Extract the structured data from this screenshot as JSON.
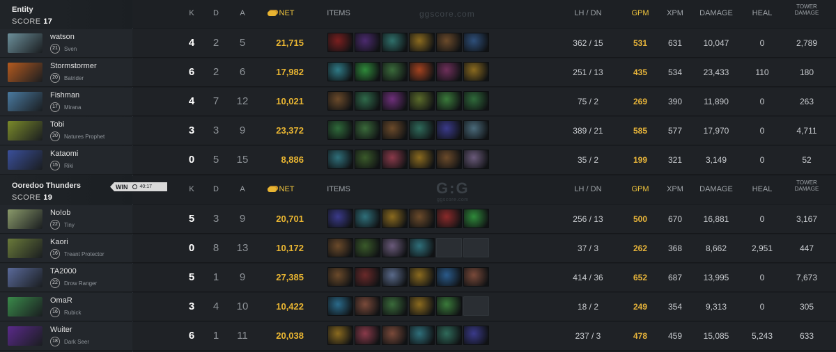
{
  "columns": {
    "k": "K",
    "d": "D",
    "a": "A",
    "net": "NET",
    "items": "ITEMS",
    "lh_dn": "LH  /  DN",
    "gpm": "GPM",
    "xpm": "XPM",
    "damage": "DAMAGE",
    "heal": "HEAL",
    "tower_damage_1": "TOWER",
    "tower_damage_2": "DAMAGE"
  },
  "watermark": {
    "top": "ggscore.com",
    "logo": "G:G",
    "logo_sub": "ggscore.com"
  },
  "teams": [
    {
      "name": "Entity",
      "score_label": "SCORE",
      "score": "17",
      "players": [
        {
          "name": "watson",
          "level": "21",
          "hero": "Sven",
          "k": "4",
          "d": "2",
          "a": "5",
          "net": "21,715",
          "lh": "362",
          "dn": "15",
          "gpm": "531",
          "xpm": "631",
          "damage": "10,047",
          "heal": "0",
          "tower": "2,789",
          "colors": [
            "#7a1f1f",
            "#4b2a6e",
            "#2f6f6a",
            "#8a6a1f",
            "#6b4a2a",
            "#2e4f7a"
          ]
        },
        {
          "name": "Stormstormer",
          "level": "20",
          "hero": "Batrider",
          "k": "6",
          "d": "2",
          "a": "6",
          "net": "17,982",
          "lh": "251",
          "dn": "13",
          "gpm": "435",
          "xpm": "534",
          "damage": "23,433",
          "heal": "110",
          "tower": "180",
          "colors": [
            "#2f7a86",
            "#2f8a3a",
            "#3a6a3a",
            "#a3421f",
            "#6e2f5a",
            "#8a6a1f"
          ]
        },
        {
          "name": "Fishman",
          "level": "17",
          "hero": "Mirana",
          "k": "4",
          "d": "7",
          "a": "12",
          "net": "10,021",
          "lh": "75",
          "dn": "2",
          "gpm": "269",
          "xpm": "390",
          "damage": "11,890",
          "heal": "0",
          "tower": "263",
          "colors": [
            "#6b4a2a",
            "#2f6a4a",
            "#6e2f7a",
            "#5a6a2a",
            "#3a7a3a",
            "#2f6a3a"
          ]
        },
        {
          "name": "Tobi",
          "level": "20",
          "hero": "Natures Prophet",
          "k": "3",
          "d": "3",
          "a": "9",
          "net": "23,372",
          "lh": "389",
          "dn": "21",
          "gpm": "585",
          "xpm": "577",
          "damage": "17,970",
          "heal": "0",
          "tower": "4,711",
          "colors": [
            "#2f6a3a",
            "#3a6a3a",
            "#6b4a2a",
            "#2f6a5a",
            "#3a3a8a",
            "#4a6a7a"
          ]
        },
        {
          "name": "Kataomi",
          "level": "15",
          "hero": "Riki",
          "k": "0",
          "d": "5",
          "a": "15",
          "net": "8,886",
          "lh": "35",
          "dn": "2",
          "gpm": "199",
          "xpm": "321",
          "damage": "3,149",
          "heal": "0",
          "tower": "52",
          "colors": [
            "#2f6f7a",
            "#3a5a2a",
            "#8a3a4a",
            "#8a6a1f",
            "#6b4a2a",
            "#6a5a7a"
          ]
        }
      ]
    },
    {
      "name": "Ooredoo Thunders",
      "score_label": "SCORE",
      "score": "19",
      "win_label": "WIN",
      "duration": "40:17",
      "players": [
        {
          "name": "No!ob",
          "level": "22",
          "hero": "Tiny",
          "k": "5",
          "d": "3",
          "a": "9",
          "net": "20,701",
          "lh": "256",
          "dn": "13",
          "gpm": "500",
          "xpm": "670",
          "damage": "16,881",
          "heal": "0",
          "tower": "3,167",
          "colors": [
            "#3a3a8a",
            "#2f6f7a",
            "#8a6a1f",
            "#6b4a2a",
            "#8a2a2a",
            "#2f8a3a"
          ]
        },
        {
          "name": "Kaori",
          "level": "16",
          "hero": "Treant Protector",
          "k": "0",
          "d": "8",
          "a": "13",
          "net": "10,172",
          "lh": "37",
          "dn": "3",
          "gpm": "262",
          "xpm": "368",
          "damage": "8,662",
          "heal": "2,951",
          "tower": "447",
          "colors": [
            "#6b4a2a",
            "#3a5a2a",
            "#6a5a7a",
            "#2f6f7a",
            "empty",
            "empty"
          ]
        },
        {
          "name": "TA2000",
          "level": "22",
          "hero": "Drow Ranger",
          "k": "5",
          "d": "1",
          "a": "9",
          "net": "27,385",
          "lh": "414",
          "dn": "36",
          "gpm": "652",
          "xpm": "687",
          "damage": "13,995",
          "heal": "0",
          "tower": "7,673",
          "colors": [
            "#6b4a2a",
            "#6a2a2a",
            "#5a6a8a",
            "#8a6a1f",
            "#2a5a8a",
            "#7a4a3a"
          ]
        },
        {
          "name": "OmaR",
          "level": "16",
          "hero": "Rubick",
          "k": "3",
          "d": "4",
          "a": "10",
          "net": "10,422",
          "lh": "18",
          "dn": "2",
          "gpm": "249",
          "xpm": "354",
          "damage": "9,313",
          "heal": "0",
          "tower": "305",
          "colors": [
            "#2a6a8a",
            "#7a4a3a",
            "#3a6a3a",
            "#8a6a1f",
            "#3a7a3a",
            "empty"
          ]
        },
        {
          "name": "Wuiter",
          "level": "18",
          "hero": "Dark Seer",
          "k": "6",
          "d": "1",
          "a": "11",
          "net": "20,038",
          "lh": "237",
          "dn": "3",
          "gpm": "478",
          "xpm": "459",
          "damage": "15,085",
          "heal": "5,243",
          "tower": "633",
          "colors": [
            "#8a6a1f",
            "#8a3a4a",
            "#7a4a3a",
            "#2f6f7a",
            "#2f6a5a",
            "#3a3a8a"
          ]
        }
      ]
    }
  ],
  "portrait_colors": [
    "#6c8f9a",
    "#b45a1f",
    "#4a7aa0",
    "#7a8a2a",
    "#3a4f9a",
    "#8a9a6a",
    "#6a7a3a",
    "#5a6a9a",
    "#3a8a4a",
    "#5a2a8a"
  ]
}
